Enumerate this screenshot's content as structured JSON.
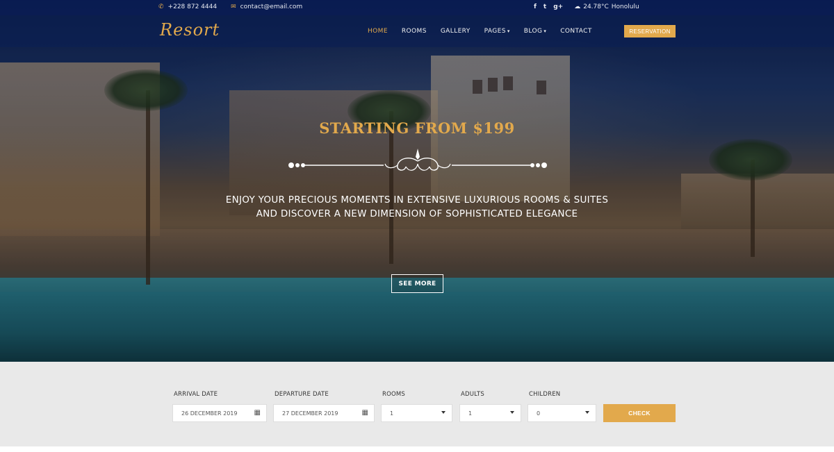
{
  "topbar": {
    "phone": "+228 872 4444",
    "email": "contact@email.com",
    "social": [
      "f",
      "t",
      "g+"
    ],
    "weather_temp": "24.78°C",
    "weather_city": "Honolulu"
  },
  "nav": {
    "logo": "Resort",
    "items": [
      {
        "label": "HOME",
        "active": true
      },
      {
        "label": "ROOMS"
      },
      {
        "label": "GALLERY"
      },
      {
        "label": "PAGES"
      },
      {
        "label": "BLOG"
      },
      {
        "label": "CONTACT"
      }
    ],
    "caret": "▾",
    "reservation": "RESERVATION"
  },
  "hero": {
    "title": "STARTING FROM $199",
    "subtitle_line1": "ENJOY YOUR PRECIOUS MOMENTS IN EXTENSIVE LUXURIOUS ROOMS & SUITES",
    "subtitle_line2": "AND DISCOVER A NEW DIMENSION OF SOPHISTICATED ELEGANCE",
    "cta": "SEE MORE"
  },
  "booking": {
    "arrival_label": "ARRIVAL DATE",
    "arrival_value": "26 DECEMBER 2019",
    "departure_label": "DEPARTURE DATE",
    "departure_value": "27 DECEMBER 2019",
    "rooms_label": "ROOMS",
    "rooms_value": "1",
    "adults_label": "ADULTS",
    "adults_value": "1",
    "children_label": "CHILDREN",
    "children_value": "0",
    "check": "CHECK"
  },
  "colors": {
    "accent": "#e2a94c",
    "nav_bg": "#0c2052",
    "booking_bg": "#e9e9e9"
  },
  "icons": {
    "phone": "phone-icon",
    "email": "envelope-icon",
    "weather": "cloud-icon",
    "calendar": "calendar-icon"
  }
}
